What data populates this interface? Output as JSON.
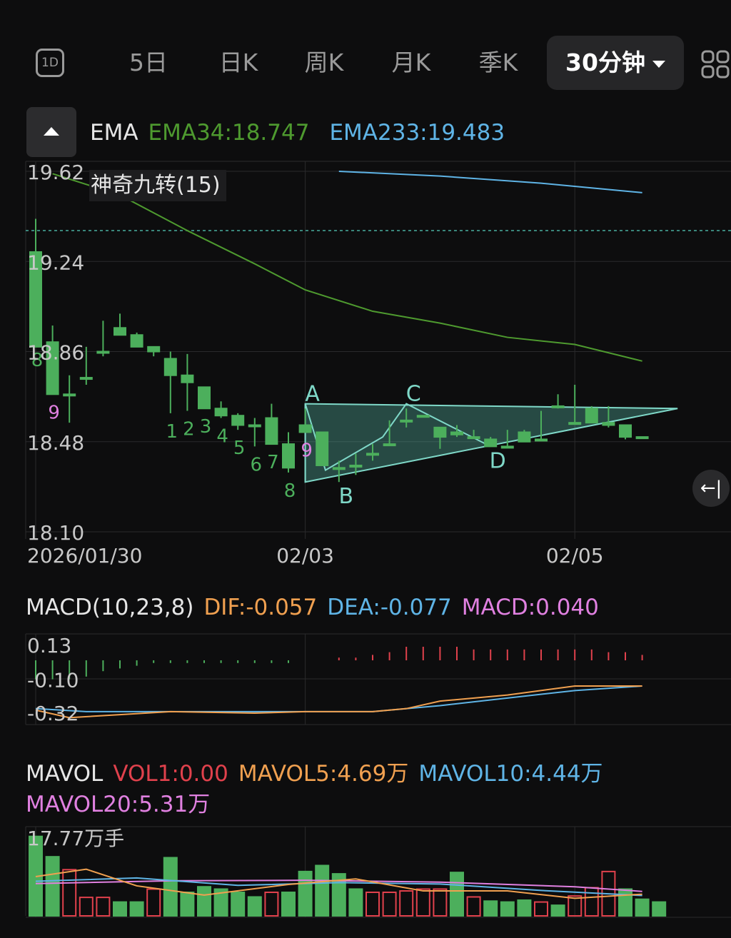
{
  "toolbar": {
    "icon_1d": "1D",
    "tabs": [
      "5日",
      "日K",
      "周K",
      "月K",
      "季K"
    ],
    "active_tab": "30分钟",
    "grid_icon": "grid-icon"
  },
  "ema_legend": {
    "name": "EMA",
    "ema34": "EMA34:18.747",
    "ema233": "EMA233:19.483",
    "colors": {
      "ema34": "#4e9a2f",
      "ema233": "#5fb4e6"
    }
  },
  "td_sequential_label": "神奇九转(15)",
  "macd_legend": {
    "name": "MACD(10,23,8)",
    "dif": "DIF:-0.057",
    "dea": "DEA:-0.077",
    "macd": "MACD:0.040"
  },
  "mavol_legend": {
    "name": "MAVOL",
    "vol1": "VOL1:0.00",
    "mavol5": "MAVOL5:4.69万",
    "mavol10": "MAVOL10:4.44万",
    "mavol20": "MAVOL20:5.31万"
  },
  "colors": {
    "up": "#e0414c",
    "down": "#4caf5c",
    "ema34": "#4e9a2f",
    "ema233": "#5fb4e6",
    "dif": "#f0a050",
    "dea": "#5fb4e6",
    "macd": "#e080e0",
    "pattern": "#7fd8c8"
  },
  "chart_data": [
    {
      "type": "candlestick",
      "y_ticks": [
        "19.62",
        "19.24",
        "18.86",
        "18.48",
        "18.10"
      ],
      "ylim": [
        18.1,
        19.62
      ],
      "x_ticks": [
        {
          "label": "2026/01/30",
          "index": 0
        },
        {
          "label": "02/03",
          "index": 16
        },
        {
          "label": "02/05",
          "index": 32
        }
      ],
      "candles": [
        [
          19.28,
          19.35,
          18.88,
          18.9,
          19.42
        ],
        [
          18.9,
          18.95,
          18.68,
          18.68,
          18.97
        ],
        [
          18.68,
          18.75,
          18.75,
          18.56,
          18.76
        ],
        [
          18.75,
          18.86,
          18.86,
          18.72,
          18.88
        ],
        [
          18.86,
          18.96,
          18.96,
          18.84,
          18.99
        ],
        [
          18.96,
          18.97,
          18.93,
          18.93,
          19.02
        ],
        [
          18.93,
          18.94,
          18.88,
          18.88,
          18.94
        ],
        [
          18.88,
          18.88,
          18.86,
          18.84,
          18.88
        ],
        [
          18.83,
          18.83,
          18.76,
          18.6,
          18.86
        ],
        [
          18.76,
          18.76,
          18.73,
          18.61,
          18.85
        ],
        [
          18.71,
          18.71,
          18.62,
          18.62,
          18.71
        ],
        [
          18.62,
          18.62,
          18.59,
          18.58,
          18.65
        ],
        [
          18.59,
          18.59,
          18.55,
          18.53,
          18.6
        ],
        [
          18.55,
          18.58,
          18.58,
          18.46,
          18.58
        ],
        [
          18.58,
          18.58,
          18.47,
          18.47,
          18.64
        ],
        [
          18.47,
          18.47,
          18.37,
          18.35,
          18.52
        ],
        [
          18.55,
          18.55,
          18.52,
          18.52,
          18.62
        ],
        [
          18.52,
          18.52,
          18.38,
          18.38,
          18.52
        ],
        [
          18.37,
          18.4,
          18.4,
          18.31,
          18.4
        ],
        [
          18.38,
          18.43,
          18.43,
          18.34,
          18.43
        ],
        [
          18.43,
          18.47,
          18.47,
          18.4,
          18.47
        ],
        [
          18.47,
          18.57,
          18.57,
          18.47,
          18.57
        ],
        [
          18.57,
          18.59,
          18.59,
          18.54,
          18.62
        ],
        [
          18.59,
          18.59,
          18.59,
          18.59,
          18.59
        ],
        [
          18.54,
          18.54,
          18.5,
          18.45,
          18.54
        ],
        [
          18.52,
          18.52,
          18.51,
          18.5,
          18.55
        ],
        [
          18.5,
          18.53,
          18.5,
          18.5,
          18.53
        ],
        [
          18.49,
          18.49,
          18.46,
          18.46,
          18.5
        ],
        [
          18.46,
          18.53,
          18.53,
          18.46,
          18.53
        ],
        [
          18.52,
          18.52,
          18.48,
          18.48,
          18.53
        ],
        [
          18.49,
          18.61,
          18.61,
          18.49,
          18.61
        ],
        [
          18.63,
          18.68,
          18.68,
          18.62,
          18.68
        ],
        [
          18.56,
          18.62,
          18.62,
          18.56,
          18.72
        ],
        [
          18.62,
          18.62,
          18.56,
          18.56,
          18.63
        ],
        [
          18.56,
          18.56,
          18.55,
          18.54,
          18.63
        ],
        [
          18.55,
          18.55,
          18.5,
          18.49,
          18.55
        ],
        [
          18.5,
          18.5,
          18.5,
          18.5,
          18.5
        ]
      ],
      "candle_fields": [
        "body_top",
        "open_or_close_high",
        "body_bottom",
        "low",
        "high"
      ],
      "ema34": [
        [
          1,
          19.61
        ],
        [
          5,
          19.52
        ],
        [
          9,
          19.37
        ],
        [
          13,
          19.23
        ],
        [
          16,
          19.12
        ],
        [
          20,
          19.03
        ],
        [
          24,
          18.98
        ],
        [
          28,
          18.92
        ],
        [
          32,
          18.89
        ],
        [
          36,
          18.82
        ]
      ],
      "ema233": [
        [
          18,
          19.62
        ],
        [
          24,
          19.6
        ],
        [
          30,
          19.57
        ],
        [
          36,
          19.53
        ]
      ],
      "reference_level": 19.37,
      "td_sequence": [
        {
          "index": 0,
          "label": "8",
          "color": "down"
        },
        {
          "index": 1,
          "label": "9",
          "color": "macd"
        },
        {
          "index": 8,
          "label": "1",
          "color": "down"
        },
        {
          "index": 9,
          "label": "2",
          "color": "down"
        },
        {
          "index": 10,
          "label": "3",
          "color": "down"
        },
        {
          "index": 11,
          "label": "4",
          "color": "down"
        },
        {
          "index": 12,
          "label": "5",
          "color": "down"
        },
        {
          "index": 13,
          "label": "6",
          "color": "down"
        },
        {
          "index": 14,
          "label": "7",
          "color": "down"
        },
        {
          "index": 15,
          "label": "8",
          "color": "down"
        },
        {
          "index": 16,
          "label": "9",
          "color": "macd"
        }
      ],
      "pattern_points": [
        {
          "label": "A",
          "index": 16,
          "price": 18.64
        },
        {
          "label": "B",
          "index": 18,
          "price": 18.31
        },
        {
          "label": "C",
          "index": 22,
          "price": 18.64
        },
        {
          "label": "D",
          "index": 27,
          "price": 18.46
        }
      ]
    },
    {
      "type": "macd",
      "name": "MACD(10,23,8)",
      "y_ticks": [
        "0.13",
        "-0.10",
        "-0.32"
      ],
      "ylim": [
        -0.32,
        0.13
      ],
      "histogram": [
        -0.07,
        -0.07,
        -0.07,
        -0.06,
        -0.04,
        -0.03,
        -0.02,
        -0.01,
        -0.01,
        -0.01,
        -0.01,
        -0.01,
        -0.01,
        -0.01,
        -0.01,
        -0.01,
        0.0,
        0.0,
        0.01,
        0.01,
        0.02,
        0.03,
        0.05,
        0.05,
        0.05,
        0.05,
        0.04,
        0.04,
        0.04,
        0.04,
        0.04,
        0.04,
        0.04,
        0.04,
        0.03,
        0.03,
        0.02
      ],
      "dif": [
        [
          0,
          -0.3
        ],
        [
          2,
          -0.35
        ],
        [
          5,
          -0.33
        ],
        [
          8,
          -0.31
        ],
        [
          13,
          -0.32
        ],
        [
          16,
          -0.31
        ],
        [
          20,
          -0.31
        ],
        [
          22,
          -0.29
        ],
        [
          24,
          -0.24
        ],
        [
          28,
          -0.2
        ],
        [
          32,
          -0.14
        ],
        [
          36,
          -0.14
        ]
      ],
      "dea": [
        [
          0,
          -0.29
        ],
        [
          3,
          -0.31
        ],
        [
          8,
          -0.31
        ],
        [
          13,
          -0.31
        ],
        [
          16,
          -0.31
        ],
        [
          20,
          -0.31
        ],
        [
          24,
          -0.27
        ],
        [
          28,
          -0.22
        ],
        [
          32,
          -0.17
        ],
        [
          36,
          -0.14
        ]
      ]
    },
    {
      "type": "volume",
      "name": "MAVOL",
      "y_max_label": "17.77万手",
      "ylim": [
        0,
        17.77
      ],
      "bars": [
        [
          17.2,
          "down"
        ],
        [
          12.8,
          "down"
        ],
        [
          10.0,
          "up"
        ],
        [
          4.0,
          "up"
        ],
        [
          4.0,
          "up"
        ],
        [
          3.0,
          "down"
        ],
        [
          3.0,
          "down"
        ],
        [
          5.8,
          "up"
        ],
        [
          12.6,
          "down"
        ],
        [
          5.1,
          "down"
        ],
        [
          6.3,
          "down"
        ],
        [
          5.8,
          "down"
        ],
        [
          5.1,
          "down"
        ],
        [
          4.1,
          "down"
        ],
        [
          5.1,
          "up"
        ],
        [
          5.1,
          "down"
        ],
        [
          9.6,
          "down"
        ],
        [
          10.9,
          "down"
        ],
        [
          9.1,
          "down"
        ],
        [
          5.8,
          "down"
        ],
        [
          5.1,
          "up"
        ],
        [
          5.1,
          "up"
        ],
        [
          5.4,
          "up"
        ],
        [
          5.8,
          "up"
        ],
        [
          5.8,
          "up"
        ],
        [
          9.4,
          "down"
        ],
        [
          4.1,
          "up"
        ],
        [
          3.2,
          "down"
        ],
        [
          3.0,
          "down"
        ],
        [
          3.4,
          "down"
        ],
        [
          3.0,
          "up"
        ],
        [
          2.3,
          "down"
        ],
        [
          4.3,
          "up"
        ],
        [
          6.1,
          "up"
        ],
        [
          9.6,
          "up"
        ],
        [
          5.8,
          "down"
        ],
        [
          3.6,
          "down"
        ],
        [
          3.0,
          "down"
        ]
      ],
      "mavol5": [
        [
          0,
          8.5
        ],
        [
          3,
          10.1
        ],
        [
          6,
          6.5
        ],
        [
          10,
          4.5
        ],
        [
          15,
          6.8
        ],
        [
          19,
          8.0
        ],
        [
          23,
          5.4
        ],
        [
          28,
          5.4
        ],
        [
          32,
          3.8
        ],
        [
          36,
          4.7
        ]
      ],
      "mavol10": [
        [
          0,
          7.5
        ],
        [
          6,
          8.2
        ],
        [
          12,
          6.6
        ],
        [
          18,
          7.2
        ],
        [
          24,
          6.9
        ],
        [
          30,
          5.5
        ],
        [
          36,
          4.4
        ]
      ],
      "mavol20": [
        [
          0,
          7.0
        ],
        [
          8,
          7.6
        ],
        [
          16,
          7.7
        ],
        [
          24,
          7.3
        ],
        [
          32,
          6.3
        ],
        [
          36,
          5.3
        ]
      ]
    }
  ]
}
